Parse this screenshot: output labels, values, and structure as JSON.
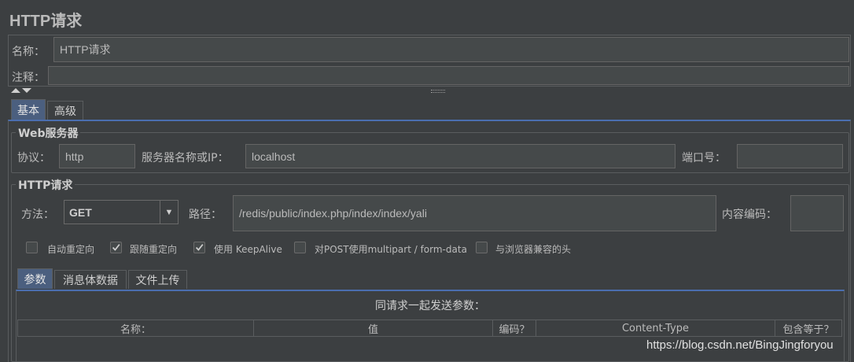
{
  "title": "HTTP请求",
  "name_field": {
    "label": "名称：",
    "value": "HTTP请求"
  },
  "comment_field": {
    "label": "注释：",
    "value": ""
  },
  "main_tabs": [
    {
      "label": "基本",
      "selected": true
    },
    {
      "label": "高级",
      "selected": false
    }
  ],
  "web_server": {
    "title": "Web服务器",
    "protocol_label": "协议：",
    "protocol_value": "http",
    "server_label": "服务器名称或IP：",
    "server_value": "localhost",
    "port_label": "端口号：",
    "port_value": ""
  },
  "http_request": {
    "title": "HTTP请求",
    "method_label": "方法：",
    "method_value": "GET",
    "path_label": "路径：",
    "path_value": "/redis/public/index.php/index/index/yali",
    "encoding_label": "内容编码：",
    "encoding_value": ""
  },
  "options": [
    {
      "label": "自动重定向",
      "checked": false
    },
    {
      "label": "跟随重定向",
      "checked": true
    },
    {
      "label": "使用 KeepAlive",
      "checked": true
    },
    {
      "label": "对POST使用multipart / form-data",
      "checked": false
    },
    {
      "label": "与浏览器兼容的头",
      "checked": false
    }
  ],
  "param_tabs": [
    {
      "label": "参数",
      "selected": true
    },
    {
      "label": "消息体数据",
      "selected": false
    },
    {
      "label": "文件上传",
      "selected": false
    }
  ],
  "params_caption": "同请求一起发送参数：",
  "table_headers": [
    "名称：",
    "值",
    "编码？",
    "Content-Type",
    "包含等于？"
  ],
  "watermark": "https://blog.csdn.net/BingJingforyou",
  "colors": {
    "background": "#3c3f41",
    "field": "#45494a",
    "accent": "#4b6eaf",
    "selected_tab": "#4b5f7f"
  }
}
